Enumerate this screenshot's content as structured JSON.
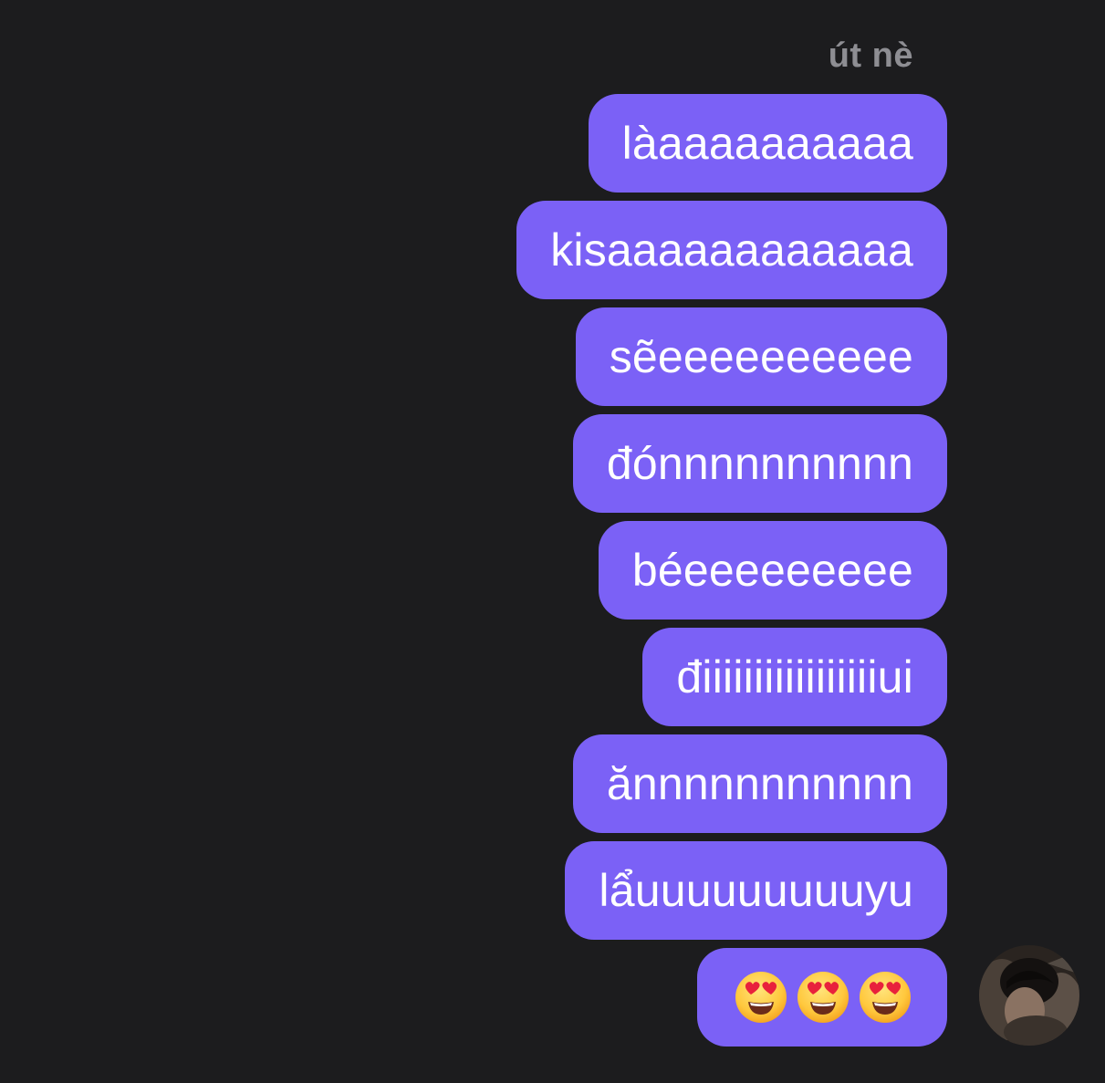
{
  "conversation": {
    "sender_name": "út nè",
    "messages": [
      "làaaaaaaaaaa",
      "kisaaaaaaaaaaaa",
      "sẽeeeeeeeeee",
      "đónnnnnnnnnn",
      "béeeeeeeeee",
      "điiiiiiiiiiiiiiiiiui",
      "ănnnnnnnnnnn",
      "lẩuuuuuuuuuyu"
    ],
    "emoji_message": {
      "emojis": [
        "smiling-face-with-heart-eyes",
        "smiling-face-with-heart-eyes",
        "smiling-face-with-heart-eyes"
      ]
    },
    "colors": {
      "background": "#1c1c1e",
      "bubble": "#7b61f6",
      "bubble_text": "#ffffff",
      "sender_name": "#8e8e93"
    },
    "avatar": {
      "icon": "user-avatar-photo"
    }
  }
}
